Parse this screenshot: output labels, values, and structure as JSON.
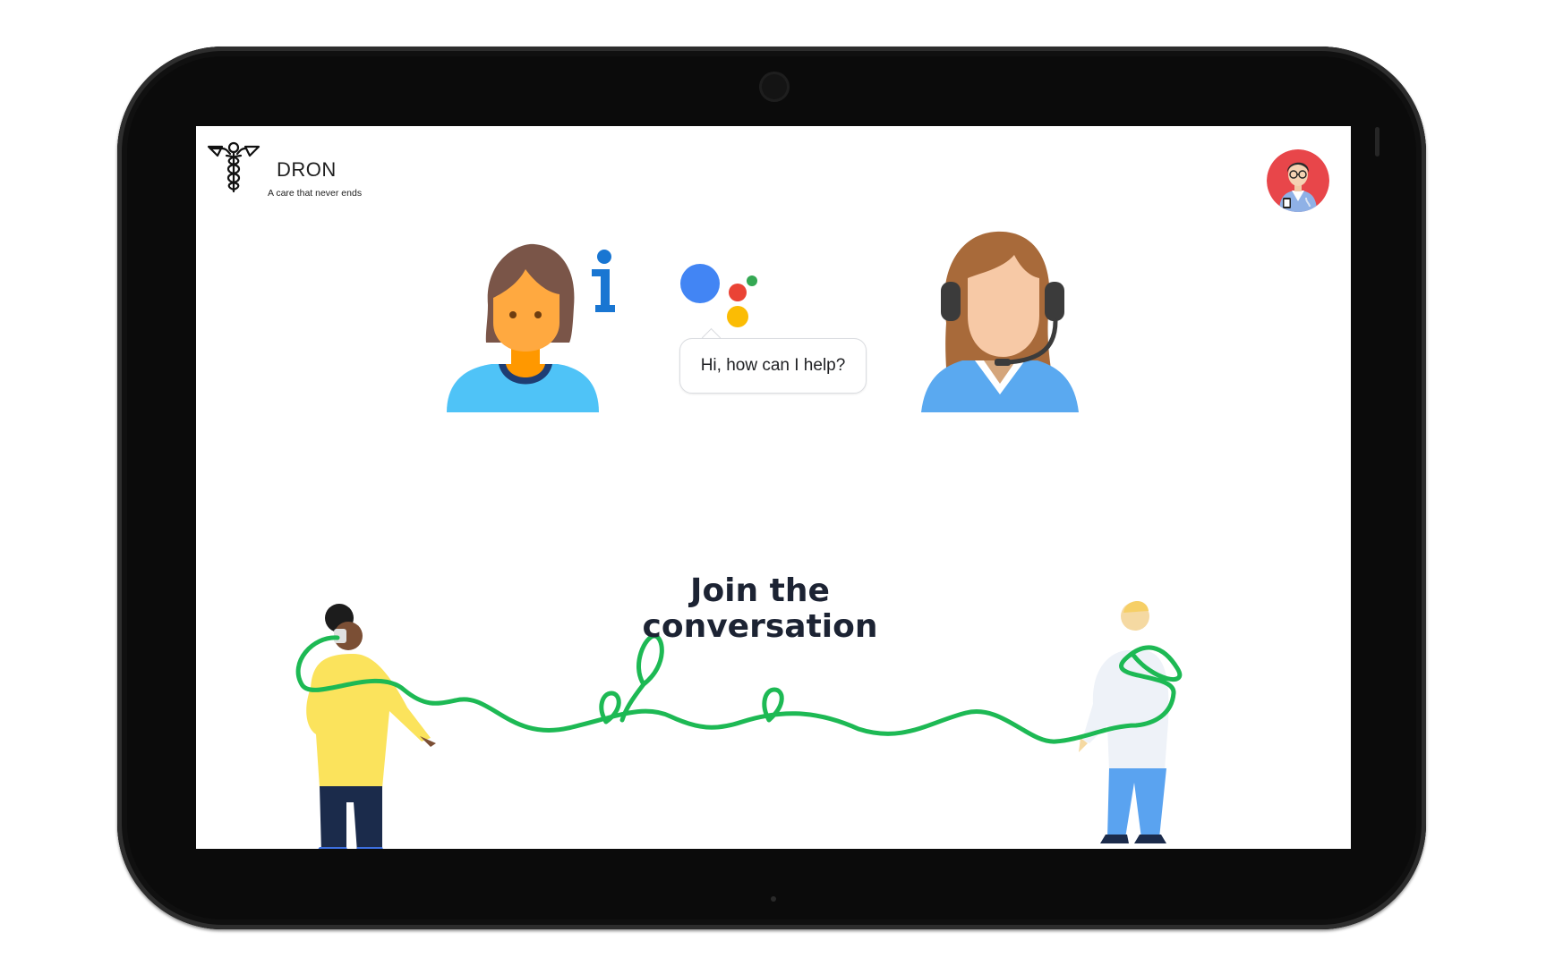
{
  "brand": {
    "name": "DRON",
    "tagline": "A care that never ends"
  },
  "assistant": {
    "bubble_text": "Hi, how can I help?",
    "dot_colors": [
      "#4285F4",
      "#EA4335",
      "#FBBC04",
      "#34A853"
    ]
  },
  "banner": {
    "line1": "Join the",
    "line2": "conversation",
    "accent_color": "#1DB954"
  },
  "icons": {
    "logo": "caduceus-icon",
    "patient": "patient-info-icon",
    "assistant": "google-assistant-icon",
    "agent": "call-center-agent-icon",
    "avatar": "doctor-avatar"
  }
}
